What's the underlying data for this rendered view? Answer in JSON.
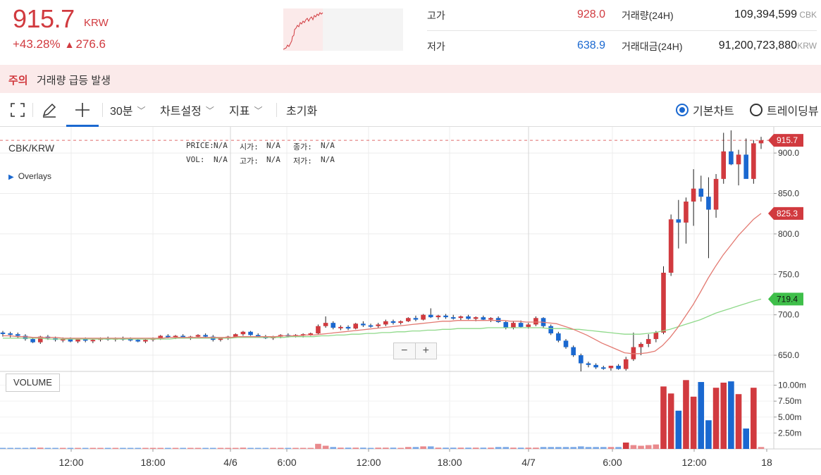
{
  "ticker": {
    "price": "915.7",
    "unit": "KRW",
    "change_pct": "+43.28%",
    "change_abs": "276.6",
    "up_arrow": "▲"
  },
  "stats": {
    "high_label": "고가",
    "high_value": "928.0",
    "low_label": "저가",
    "low_value": "638.9",
    "volume_label": "거래량(24H)",
    "volume_value": "109,394,599",
    "volume_unit": "CBK",
    "amount_label": "거래대금(24H)",
    "amount_value": "91,200,723,880",
    "amount_unit": "KRW"
  },
  "notice": {
    "tag": "주의",
    "message": "거래량 급등 발생"
  },
  "toolbar": {
    "interval": "30분",
    "chart_settings": "차트설정",
    "indicators": "지표",
    "reset": "초기화",
    "basic_chart": "기본차트",
    "tradingview": "트레이딩뷰"
  },
  "chart_panel": {
    "symbol": "CBK/KRW",
    "overlays": "Overlays",
    "volume_button": "VOLUME",
    "legend": {
      "price_label": "PRICE:",
      "price_value": "N/A",
      "open_label": "시가:",
      "open_value": "N/A",
      "close_label": "종가:",
      "close_value": "N/A",
      "vol_label": "VOL:",
      "vol_value": "N/A",
      "high_label": "고가:",
      "high_value": "N/A",
      "low_label": "저가:",
      "low_value": "N/A"
    },
    "zoom_out": "−",
    "zoom_in": "+"
  },
  "chart_data": {
    "type": "candlestick",
    "ylim": [
      630,
      928
    ],
    "y_ticks": [
      "900.0",
      "850.0",
      "800.0",
      "750.0",
      "700.0",
      "650.0"
    ],
    "y_tick_values": [
      900,
      850,
      800,
      750,
      700,
      650
    ],
    "volume_ticks": [
      "10.00m",
      "7.50m",
      "5.00m",
      "2.50m"
    ],
    "volume_tick_values": [
      10,
      7.5,
      5,
      2.5
    ],
    "x_ticks": [
      "12:00",
      "18:00",
      "4/6",
      "6:00",
      "12:00",
      "18:00",
      "4/7",
      "6:00",
      "12:00",
      "18"
    ],
    "price_tags": [
      {
        "label": "915.7",
        "value": 915.7,
        "color": "#d13a3f"
      },
      {
        "label": "825.3",
        "value": 825.3,
        "color": "#d13a3f"
      },
      {
        "label": "719.4",
        "value": 719.4,
        "color": "#3fbf4a"
      }
    ],
    "candles": [
      [
        678,
        680,
        673,
        677,
        0.1
      ],
      [
        677,
        679,
        672,
        676,
        0.1
      ],
      [
        676,
        678,
        671,
        674,
        0.1
      ],
      [
        674,
        676,
        668,
        670,
        0.1
      ],
      [
        670,
        672,
        665,
        666,
        0.2
      ],
      [
        666,
        674,
        664,
        673,
        0.2
      ],
      [
        673,
        675,
        669,
        671,
        0.1
      ],
      [
        671,
        673,
        667,
        669,
        0.1
      ],
      [
        669,
        672,
        666,
        670,
        0.1
      ],
      [
        670,
        672,
        666,
        667,
        0.1
      ],
      [
        667,
        671,
        665,
        670,
        0.1
      ],
      [
        670,
        672,
        666,
        668,
        0.1
      ],
      [
        668,
        671,
        665,
        669,
        0.1
      ],
      [
        669,
        672,
        667,
        671,
        0.1
      ],
      [
        671,
        673,
        668,
        670,
        0.1
      ],
      [
        670,
        672,
        667,
        671,
        0.1
      ],
      [
        671,
        673,
        668,
        670,
        0.1
      ],
      [
        670,
        672,
        667,
        669,
        0.1
      ],
      [
        669,
        671,
        666,
        667,
        0.1
      ],
      [
        667,
        670,
        665,
        669,
        0.1
      ],
      [
        669,
        672,
        667,
        671,
        0.1
      ],
      [
        671,
        675,
        669,
        674,
        0.1
      ],
      [
        674,
        676,
        671,
        673,
        0.1
      ],
      [
        673,
        675,
        670,
        674,
        0.1
      ],
      [
        674,
        676,
        671,
        672,
        0.1
      ],
      [
        672,
        674,
        669,
        673,
        0.1
      ],
      [
        673,
        676,
        671,
        675,
        0.1
      ],
      [
        675,
        677,
        672,
        673,
        0.1
      ],
      [
        673,
        675,
        667,
        669,
        0.1
      ],
      [
        669,
        672,
        667,
        671,
        0.1
      ],
      [
        671,
        674,
        669,
        673,
        0.1
      ],
      [
        673,
        677,
        672,
        676,
        0.1
      ],
      [
        676,
        680,
        674,
        679,
        0.2
      ],
      [
        679,
        680,
        674,
        675,
        0.1
      ],
      [
        675,
        677,
        672,
        673,
        0.1
      ],
      [
        673,
        675,
        670,
        671,
        0.1
      ],
      [
        671,
        674,
        669,
        673,
        0.1
      ],
      [
        673,
        676,
        671,
        675,
        0.1
      ],
      [
        675,
        677,
        672,
        674,
        0.1
      ],
      [
        674,
        676,
        672,
        675,
        0.1
      ],
      [
        675,
        677,
        672,
        676,
        0.1
      ],
      [
        676,
        678,
        674,
        677,
        0.1
      ],
      [
        677,
        688,
        676,
        686,
        0.8
      ],
      [
        686,
        698,
        684,
        690,
        0.5
      ],
      [
        690,
        692,
        682,
        684,
        0.3
      ],
      [
        684,
        687,
        681,
        685,
        0.2
      ],
      [
        685,
        687,
        681,
        683,
        0.2
      ],
      [
        683,
        690,
        682,
        689,
        0.2
      ],
      [
        689,
        692,
        685,
        687,
        0.2
      ],
      [
        687,
        689,
        684,
        686,
        0.1
      ],
      [
        686,
        690,
        684,
        688,
        0.2
      ],
      [
        688,
        694,
        686,
        692,
        0.2
      ],
      [
        692,
        694,
        688,
        690,
        0.2
      ],
      [
        690,
        693,
        688,
        692,
        0.1
      ],
      [
        692,
        697,
        691,
        696,
        0.3
      ],
      [
        696,
        699,
        692,
        694,
        0.3
      ],
      [
        694,
        701,
        693,
        700,
        0.4
      ],
      [
        700,
        708,
        696,
        697,
        0.4
      ],
      [
        697,
        700,
        694,
        699,
        0.2
      ],
      [
        699,
        701,
        695,
        697,
        0.2
      ],
      [
        697,
        700,
        694,
        696,
        0.2
      ],
      [
        696,
        699,
        693,
        698,
        0.2
      ],
      [
        698,
        700,
        694,
        695,
        0.2
      ],
      [
        695,
        698,
        692,
        697,
        0.2
      ],
      [
        697,
        699,
        693,
        694,
        0.2
      ],
      [
        694,
        697,
        691,
        696,
        0.2
      ],
      [
        696,
        698,
        690,
        691,
        0.3
      ],
      [
        691,
        693,
        682,
        684,
        0.3
      ],
      [
        684,
        692,
        682,
        690,
        0.2
      ],
      [
        690,
        693,
        684,
        685,
        0.2
      ],
      [
        685,
        690,
        683,
        688,
        0.2
      ],
      [
        688,
        698,
        686,
        696,
        0.2
      ],
      [
        696,
        697,
        684,
        686,
        0.3
      ],
      [
        686,
        688,
        675,
        677,
        0.3
      ],
      [
        677,
        679,
        666,
        668,
        0.3
      ],
      [
        668,
        670,
        658,
        660,
        0.3
      ],
      [
        660,
        662,
        648,
        650,
        0.3
      ],
      [
        650,
        652,
        630,
        640,
        0.4
      ],
      [
        640,
        642,
        635,
        638,
        0.3
      ],
      [
        638,
        640,
        633,
        635,
        0.3
      ],
      [
        635,
        637,
        632,
        634,
        0.3
      ],
      [
        634,
        636,
        631,
        637,
        0.3
      ],
      [
        637,
        639,
        632,
        633,
        0.3
      ],
      [
        633,
        648,
        631,
        645,
        1.0
      ],
      [
        645,
        678,
        643,
        660,
        0.6
      ],
      [
        660,
        666,
        650,
        664,
        0.5
      ],
      [
        664,
        676,
        660,
        670,
        0.6
      ],
      [
        670,
        680,
        666,
        678,
        0.7
      ],
      [
        678,
        760,
        676,
        752,
        9.8
      ],
      [
        752,
        824,
        748,
        818,
        8.7
      ],
      [
        818,
        842,
        782,
        814,
        6.0
      ],
      [
        814,
        845,
        788,
        840,
        10.8
      ],
      [
        840,
        880,
        810,
        856,
        8.2
      ],
      [
        856,
        872,
        840,
        846,
        10.5
      ],
      [
        846,
        870,
        770,
        830,
        4.5
      ],
      [
        830,
        874,
        820,
        868,
        9.6
      ],
      [
        868,
        925,
        862,
        902,
        10.4
      ],
      [
        902,
        928,
        885,
        886,
        10.6
      ],
      [
        886,
        904,
        860,
        898,
        8.6
      ],
      [
        898,
        918,
        878,
        868,
        3.2
      ],
      [
        868,
        916,
        862,
        912,
        9.6
      ],
      [
        912,
        920,
        905,
        915.7,
        0.3
      ]
    ],
    "ma_red": [
      674,
      674,
      673,
      673,
      672,
      672,
      672,
      672,
      671,
      671,
      671,
      671,
      671,
      671,
      671,
      671,
      671,
      671,
      671,
      671,
      671,
      671,
      672,
      672,
      672,
      672,
      672,
      672,
      672,
      672,
      672,
      673,
      673,
      673,
      673,
      673,
      673,
      674,
      674,
      674,
      675,
      675,
      676,
      677,
      678,
      679,
      680,
      681,
      682,
      683,
      684,
      685,
      686,
      687,
      688,
      689,
      690,
      691,
      692,
      692,
      693,
      693,
      693,
      693,
      693,
      693,
      693,
      692,
      692,
      691,
      691,
      691,
      690,
      689,
      686,
      683,
      679,
      675,
      670,
      665,
      661,
      657,
      653,
      652,
      652,
      653,
      655,
      662,
      672,
      684,
      698,
      712,
      728,
      745,
      760,
      774,
      786,
      798,
      808,
      818,
      825.3
    ],
    "ma_green": [
      671,
      671,
      671,
      671,
      671,
      671,
      670,
      670,
      670,
      670,
      670,
      670,
      670,
      670,
      670,
      670,
      670,
      670,
      670,
      670,
      670,
      670,
      670,
      671,
      671,
      671,
      671,
      671,
      671,
      671,
      671,
      672,
      672,
      672,
      672,
      672,
      672,
      672,
      673,
      673,
      673,
      673,
      674,
      674,
      675,
      675,
      676,
      676,
      677,
      677,
      678,
      678,
      679,
      679,
      680,
      680,
      681,
      681,
      682,
      682,
      683,
      683,
      683,
      683,
      684,
      684,
      684,
      684,
      684,
      684,
      684,
      684,
      683,
      683,
      683,
      682,
      682,
      681,
      680,
      679,
      678,
      677,
      676,
      676,
      676,
      677,
      678,
      680,
      682,
      685,
      688,
      691,
      694,
      698,
      702,
      705,
      708,
      711,
      714,
      717,
      719.4
    ]
  }
}
